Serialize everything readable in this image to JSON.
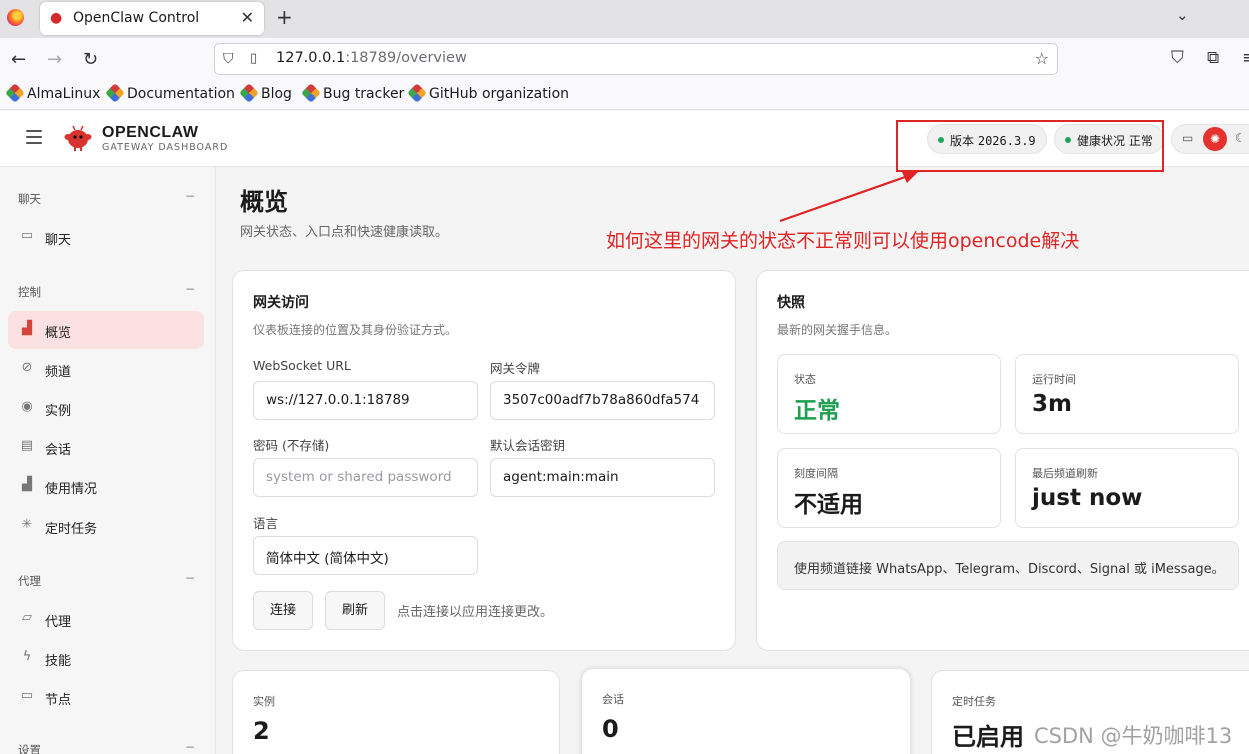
{
  "browser": {
    "tab_title": "OpenClaw Control",
    "url_host": "127.0.0.1",
    "url_rest": ":18789/overview",
    "bookmarks": [
      "AlmaLinux",
      "Documentation",
      "Blog",
      "Bug tracker",
      "GitHub organization"
    ]
  },
  "header": {
    "brand": "OPENCLAW",
    "brand_sub": "GATEWAY DASHBOARD",
    "version_label": "版本",
    "version_value": "2026.3.9",
    "health_label": "健康状况",
    "health_value": "正常"
  },
  "sidebar": {
    "sections": [
      {
        "title": "聊天",
        "toggle": "−",
        "items": [
          {
            "label": "聊天",
            "icon": "chat-icon"
          }
        ]
      },
      {
        "title": "控制",
        "toggle": "−",
        "items": [
          {
            "label": "概览",
            "icon": "bar-chart-icon",
            "active": true
          },
          {
            "label": "频道",
            "icon": "link-icon"
          },
          {
            "label": "实例",
            "icon": "radio-icon"
          },
          {
            "label": "会话",
            "icon": "document-icon"
          },
          {
            "label": "使用情况",
            "icon": "bar-chart-icon"
          },
          {
            "label": "定时任务",
            "icon": "loader-icon"
          }
        ]
      },
      {
        "title": "代理",
        "toggle": "−",
        "items": [
          {
            "label": "代理",
            "icon": "folder-icon"
          },
          {
            "label": "技能",
            "icon": "bolt-icon"
          },
          {
            "label": "节点",
            "icon": "monitor-icon"
          }
        ]
      },
      {
        "title": "设置",
        "toggle": "−",
        "items": []
      }
    ]
  },
  "page": {
    "title": "概览",
    "subtitle": "网关状态、入口点和快速健康读取。"
  },
  "annotation": "如何这里的网关的状态不正常则可以使用opencode解决",
  "gateway_card": {
    "title": "网关访问",
    "subtitle": "仪表板连接的位置及其身份验证方式。",
    "ws_label": "WebSocket URL",
    "ws_value": "ws://127.0.0.1:18789",
    "token_label": "网关令牌",
    "token_value": "3507c00adf7b78a860dfa574",
    "password_label": "密码 (不存储)",
    "password_placeholder": "system or shared password",
    "session_key_label": "默认会话密钥",
    "session_key_value": "agent:main:main",
    "language_label": "语言",
    "language_value": "简体中文 (简体中文)",
    "connect_button": "连接",
    "refresh_button": "刷新",
    "hint": "点击连接以应用连接更改。"
  },
  "snapshot_card": {
    "title": "快照",
    "subtitle": "最新的网关握手信息。",
    "stats": [
      {
        "label": "状态",
        "value": "正常"
      },
      {
        "label": "运行时间",
        "value": "3m"
      },
      {
        "label": "刻度间隔",
        "value": "不适用"
      },
      {
        "label": "最后频道刷新",
        "value": "just now"
      }
    ],
    "callout": "使用频道链接 WhatsApp、Telegram、Discord、Signal 或 iMessage。"
  },
  "bottom_cards": [
    {
      "label": "实例",
      "value": "2"
    },
    {
      "label": "会话",
      "value": "0"
    },
    {
      "label": "定时任务",
      "value": "已启用"
    }
  ],
  "watermark": "CSDN @牛奶咖啡13",
  "colors": {
    "accent": "#e5312f",
    "health_dot": "#22a55a",
    "status_ok": "#1e9e4f",
    "annotation": "#e02424"
  }
}
